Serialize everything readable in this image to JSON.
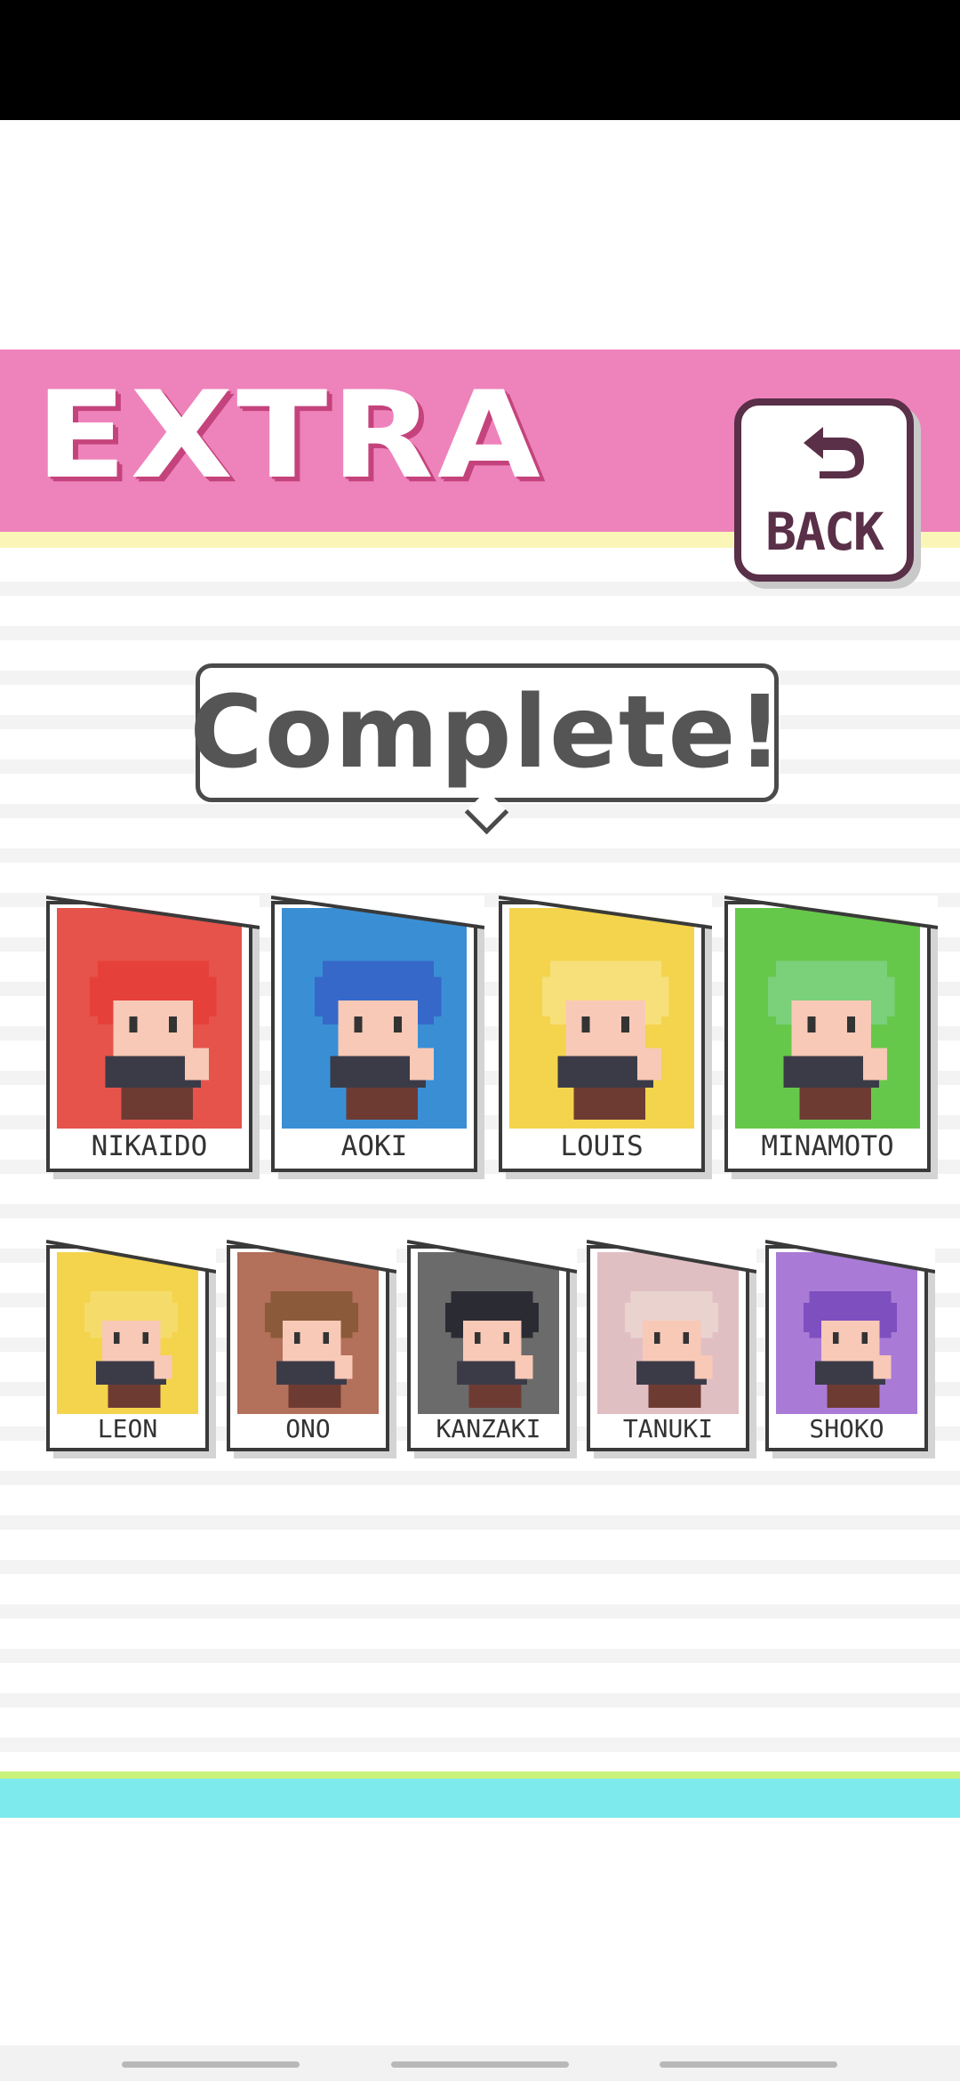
{
  "header": {
    "title": "EXTRA",
    "back_label": "BACK"
  },
  "banner": {
    "text": "Complete!"
  },
  "characters": [
    {
      "name": "NIKAIDO",
      "color": "#e5534b",
      "hair": "#e6403a"
    },
    {
      "name": "AOKI",
      "color": "#3a8fd4",
      "hair": "#3568c9"
    },
    {
      "name": "LOUIS",
      "color": "#f3d44c",
      "hair": "#f7e07a"
    },
    {
      "name": "MINAMOTO",
      "color": "#66c84a",
      "hair": "#7bd07a"
    },
    {
      "name": "LEON",
      "color": "#f3d44c",
      "hair": "#f5dc6a"
    },
    {
      "name": "ONO",
      "color": "#b3705a",
      "hair": "#8a5a3a"
    },
    {
      "name": "KANZAKI",
      "color": "#6b6b6b",
      "hair": "#2b2b33"
    },
    {
      "name": "TANUKI",
      "color": "#e0bfc3",
      "hair": "#ead3cf"
    },
    {
      "name": "SHOKO",
      "color": "#a97bd6",
      "hair": "#7d4fbf"
    }
  ],
  "colors": {
    "header": "#ee83bb",
    "accent_dark": "#5a2f48",
    "footer": "#7debee"
  }
}
